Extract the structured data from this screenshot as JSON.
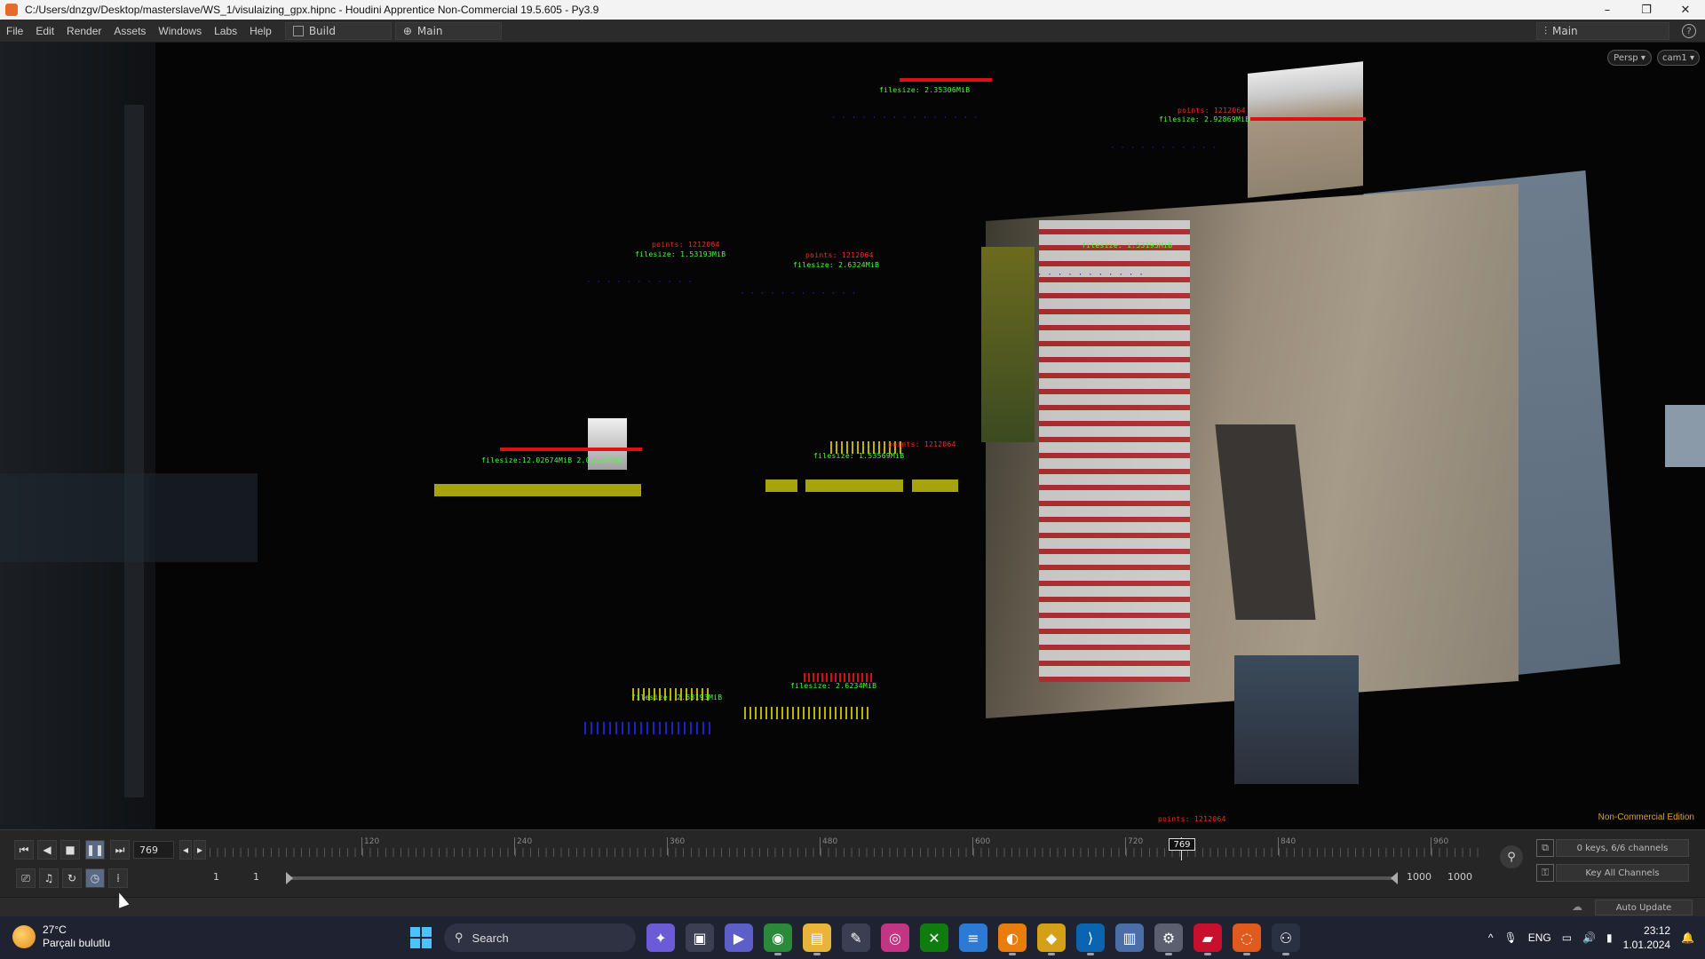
{
  "window": {
    "title": "C:/Users/dnzgv/Desktop/masterslave/WS_1/visulaizing_gpx.hipnc - Houdini Apprentice Non-Commercial 19.5.605 - Py3.9",
    "minimize": "–",
    "maximize": "❐",
    "close": "✕"
  },
  "menubar": {
    "items": [
      "File",
      "Edit",
      "Render",
      "Assets",
      "Windows",
      "Labs",
      "Help"
    ],
    "desktop": "Build",
    "pane": "Main",
    "right_desktop": "Main",
    "help_glyph": "?"
  },
  "viewport": {
    "persp_label": "Persp ▾",
    "cam_label": "cam1 ▾",
    "edition_label": "Non-Commercial Edition",
    "overlay_labels": {
      "green_1": "filesize: 2.35306MiB",
      "green_2": "filesize: 1.53193MiB",
      "green_3": "filesize: 2.6324MiB",
      "green_4": "filesize: 2.92869MiB",
      "green_5": "filesize: 1.53193MiB",
      "green_6": "filesize:12.02674MiB 2.02624MiB",
      "green_7": "filesize: 1.53569MiB",
      "green_8": "filesize: 2.53193MiB",
      "green_9": "filesize: 2.6234MiB",
      "green_10": "filesize: 2.92869MiB",
      "red_1": "points: 1212064",
      "red_2": "points: 1212064",
      "red_3": "points: 1212064",
      "red_4": "points: 1212064",
      "red_5": "points: 1212064",
      "blue_1": "· · · ·  · · · ·  · ·  · · · · ·",
      "blue_2": "· · ·  · · · ·  · · · ·",
      "blue_3": "· · ·  · · · ·  · · · ·",
      "blue_4": "· · ·  · · · ·  · · · · ·",
      "blue_5": "· · ·  · · · ·  · · · ·"
    }
  },
  "playbar": {
    "current_frame": "769",
    "start_frame": "1",
    "start_frame_2": "1",
    "end_frame": "1000",
    "end_frame_2": "1000",
    "tick_labels": [
      "120",
      "240",
      "360",
      "480",
      "600",
      "720",
      "840",
      "960"
    ],
    "cursor_label": "769",
    "keys_info": "0 keys, 6/6 channels",
    "key_all": "Key All Channels",
    "buttons": {
      "first": "⏮",
      "prev": "◀",
      "stop": "■",
      "pause": "❚❚",
      "last": "⏭",
      "step_back": "◂",
      "step_fwd": "▸"
    }
  },
  "statusbar": {
    "auto_update": "Auto Update"
  },
  "taskbar": {
    "temperature": "27°C",
    "weather_text": "Parçalı bulutlu",
    "search": "Search",
    "language": "ENG",
    "time": "23:12",
    "date": "1.01.2024"
  },
  "colors": {
    "accent": "#4cc2ff",
    "label_green": "#4cff3a",
    "label_red": "#ff2a1f",
    "label_blue": "#1b24d6",
    "bar_yellow": "#a6a40e",
    "edition_orange": "#d9a320"
  }
}
